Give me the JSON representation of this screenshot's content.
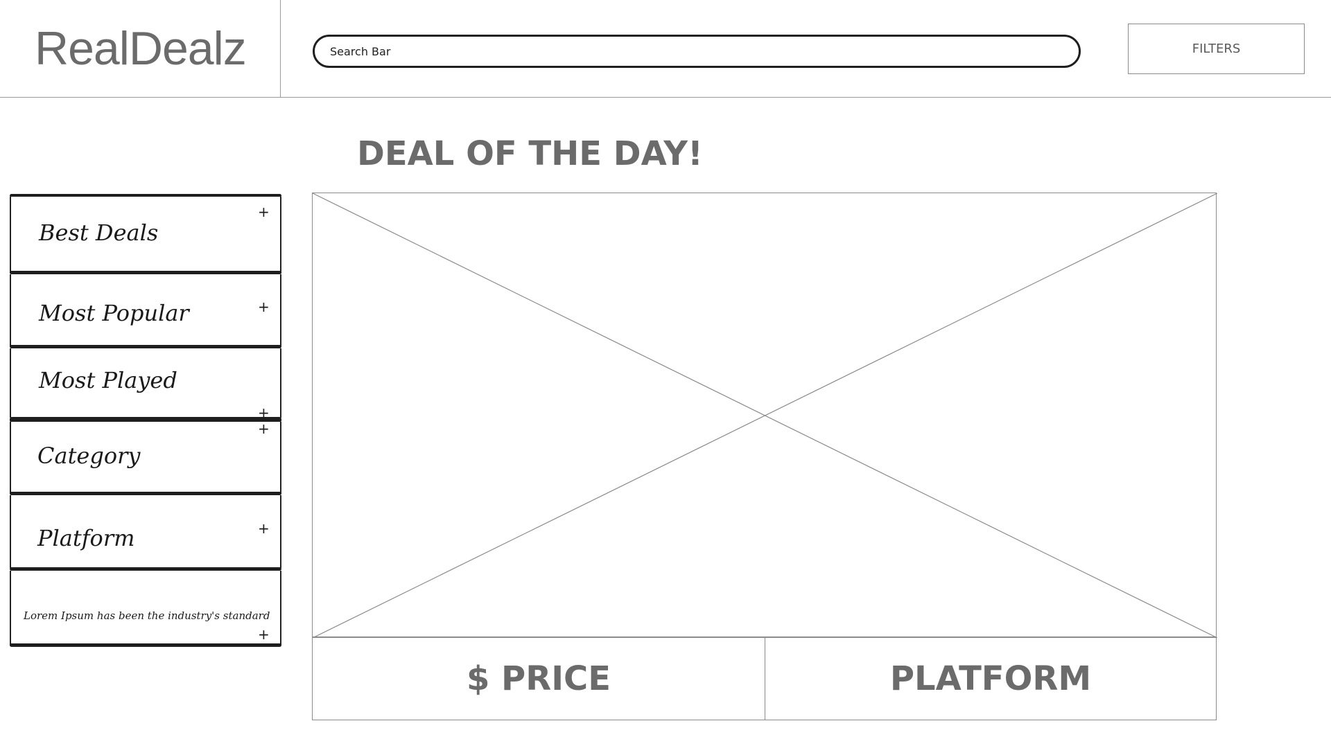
{
  "header": {
    "logo": "RealDealz",
    "search_placeholder": "Search Bar",
    "filters_label": "FILTERS"
  },
  "main": {
    "title": "DEAL OF THE DAY!",
    "price_label": "$ PRICE",
    "platform_label": "PLATFORM"
  },
  "sidebar": {
    "items": [
      {
        "label": "Best Deals",
        "icon": "plus-icon"
      },
      {
        "label": "Most Popular",
        "icon": "plus-icon"
      },
      {
        "label": "Most Played",
        "icon": "plus-icon"
      },
      {
        "label": "Category",
        "icon": "plus-icon"
      },
      {
        "label": "Platform",
        "icon": "plus-icon"
      },
      {
        "label": "Lorem Ipsum has been the industry's standard",
        "icon": "plus-icon"
      }
    ],
    "plus_glyph": "+"
  }
}
